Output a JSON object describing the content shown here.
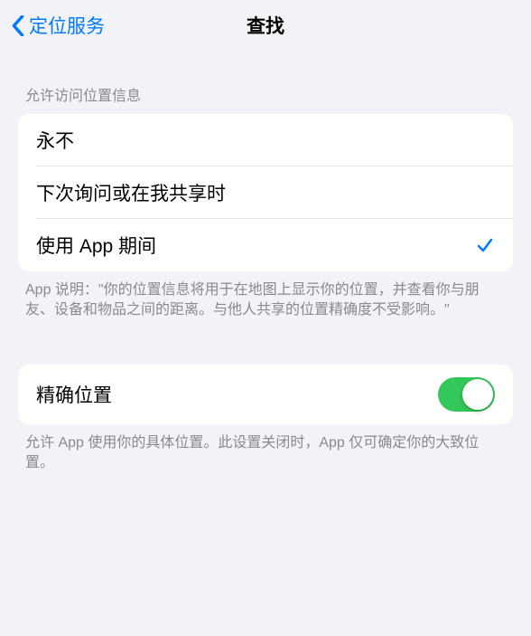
{
  "nav": {
    "back_label": "定位服务",
    "title": "查找"
  },
  "location_access": {
    "header": "允许访问位置信息",
    "options": {
      "never": "永不",
      "ask_next_time": "下次询问或在我共享时",
      "while_using": "使用 App 期间"
    },
    "selected": "while_using",
    "footer": "App 说明：\"你的位置信息将用于在地图上显示你的位置，并查看你与朋友、设备和物品之间的距离。与他人共享的位置精确度不受影响。\""
  },
  "precise": {
    "label": "精确位置",
    "enabled": true,
    "footer": "允许 App 使用你的具体位置。此设置关闭时，App 仅可确定你的大致位置。"
  }
}
